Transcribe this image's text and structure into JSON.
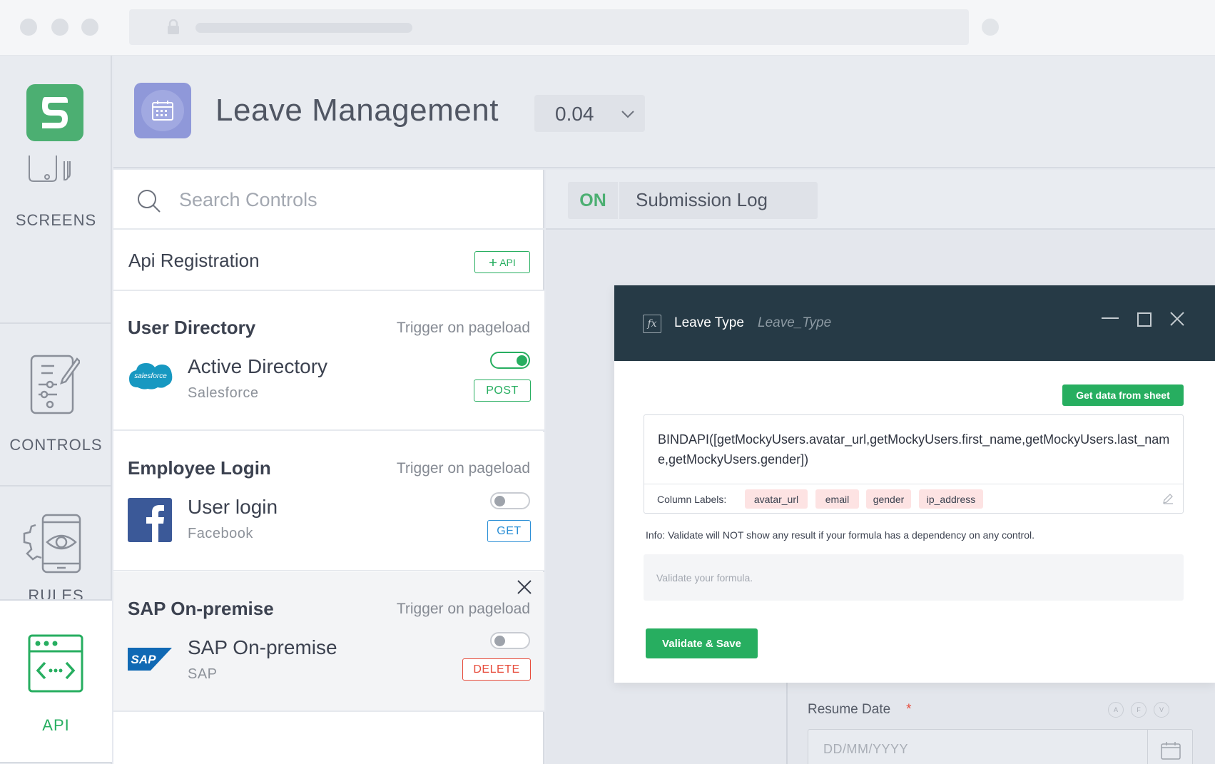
{
  "browser": {
    "url_text": ""
  },
  "sidebar": {
    "items": [
      {
        "label": "SCREENS",
        "icon": "screens-icon"
      },
      {
        "label": "CONTROLS",
        "icon": "controls-icon"
      },
      {
        "label": "RULES",
        "icon": "rules-icon"
      },
      {
        "label": "API",
        "icon": "api-icon",
        "active": true
      }
    ]
  },
  "header": {
    "title": "Leave Management",
    "version": "0.04"
  },
  "panel": {
    "search_placeholder": "Search Controls",
    "api_registration": {
      "title": "Api Registration",
      "button": "API"
    },
    "cards": [
      {
        "title": "User Directory",
        "trigger": "Trigger on pageload",
        "name": "Active Directory",
        "provider": "Salesforce",
        "logo_text": "salesforce",
        "toggle_on": true,
        "method": "POST"
      },
      {
        "title": "Employee Login",
        "trigger": "Trigger on pageload",
        "name": "User login",
        "provider": "Facebook",
        "logo_text": "f",
        "toggle_on": false,
        "method": "GET"
      },
      {
        "title": "SAP On-premise",
        "trigger": "Trigger on pageload",
        "name": "SAP On-premise",
        "provider": "SAP",
        "logo_text": "SAP",
        "toggle_on": false,
        "method": "DELETE"
      }
    ]
  },
  "right": {
    "status": "ON",
    "tab": "Submission Log",
    "form": {
      "resume_label": "Resume Date",
      "required_mark": "*",
      "badges": [
        "A",
        "F",
        "V"
      ],
      "date_placeholder": "DD/MM/YYYY"
    }
  },
  "modal": {
    "fx": "fx",
    "title": "Leave Type",
    "subtitle": "Leave_Type",
    "sheet_button": "Get data from sheet",
    "formula": "BINDAPI([getMockyUsers.avatar_url,getMockyUsers.first_name,getMockyUsers.last_name,getMockyUsers.gender])",
    "column_labels_title": "Column Labels:",
    "column_labels": [
      "avatar_url",
      "email",
      "gender",
      "ip_address"
    ],
    "info": "Info: Validate will NOT show any result if your formula has a dependency on any control.",
    "validate_placeholder": "Validate your formula.",
    "save_button": "Validate & Save"
  },
  "colors": {
    "accent_green": "#27ae60",
    "modal_header": "#263a46",
    "get_blue": "#2b8fd6",
    "delete_red": "#e74c3c",
    "chip_pink": "#fde3e3"
  }
}
